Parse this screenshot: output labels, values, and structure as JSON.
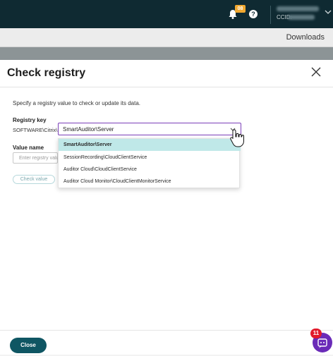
{
  "header": {
    "notification_count": "08",
    "help_glyph": "?",
    "ccid_label": "CCID:"
  },
  "subbar": {
    "downloads_label": "Downloads"
  },
  "dialog": {
    "title": "Check registry",
    "description": "Specify a registry value to check or update its data.",
    "registry_key_label": "Registry key",
    "registry_prefix": "SOFTWARE\\Citrix\\",
    "selected_key": "SmartAuditor\\Server",
    "value_name_label": "Value name",
    "value_placeholder": "Enter registry value",
    "check_button": "Check value",
    "options": [
      "SmartAuditor\\Server",
      "SessionRecording\\CloudClientService",
      "Auditor Cloud\\CloudClientService",
      "Auditor Cloud Monitor\\CloudClientMonitorService"
    ],
    "close_button": "Close"
  },
  "widget": {
    "badge_count": "11"
  },
  "colors": {
    "header_bg": "#0f2a32",
    "accent_focus": "#7b3fb8",
    "selected_option_bg": "#bfe8e8",
    "primary_button": "#0f5663",
    "widget_bg": "#6a2bb8",
    "widget_badge": "#e21b2c"
  },
  "icons": [
    "bell-icon",
    "help-icon",
    "close-icon",
    "chevron-down-icon",
    "hand-cursor-icon",
    "assistant-icon"
  ]
}
